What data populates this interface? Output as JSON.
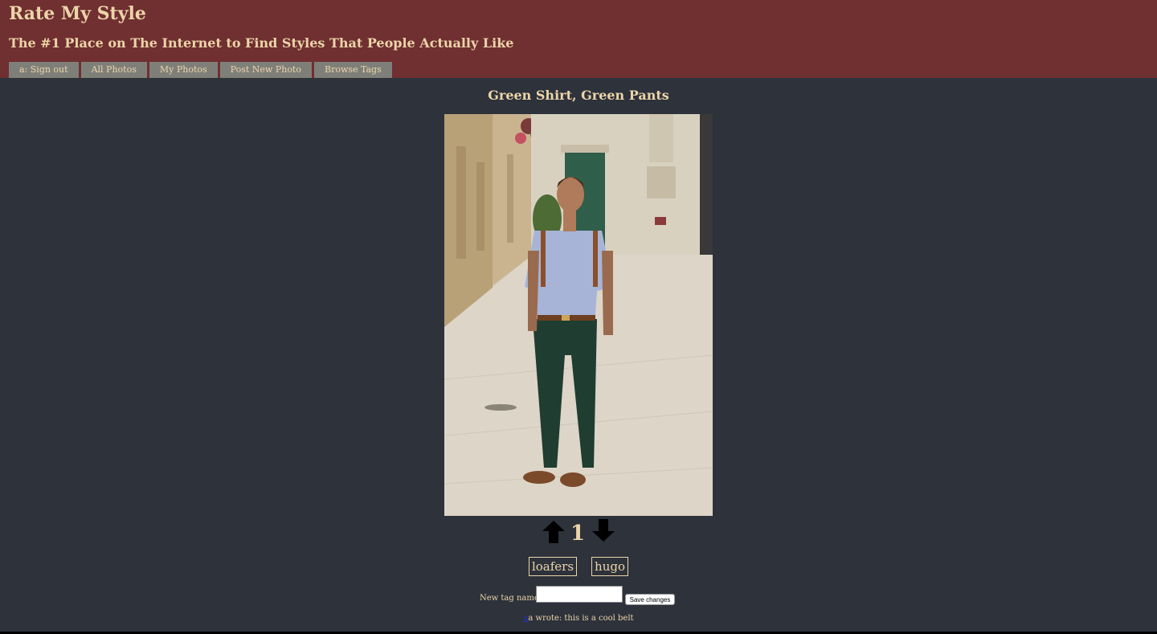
{
  "header": {
    "title": "Rate My Style",
    "subtitle": "The #1 Place on The Internet to Find Styles That People Actually Like"
  },
  "nav": {
    "items": [
      {
        "label": "a: Sign out"
      },
      {
        "label": "All Photos"
      },
      {
        "label": "My Photos"
      },
      {
        "label": "Post New Photo"
      },
      {
        "label": "Browse Tags"
      }
    ]
  },
  "photo": {
    "title": "Green Shirt, Green Pants",
    "votes": "1"
  },
  "tags": [
    {
      "label": "loafers"
    },
    {
      "label": "hugo"
    }
  ],
  "tag_form": {
    "label": "New tag name",
    "value": "",
    "button_label": "Save changes"
  },
  "comment": {
    "author": "a",
    "text": "a wrote: this is a cool belt"
  },
  "colors": {
    "header_bg": "#702f30",
    "content_bg": "#2d323b",
    "text": "#ecd5a9",
    "nav_bg": "#7f7f79"
  }
}
